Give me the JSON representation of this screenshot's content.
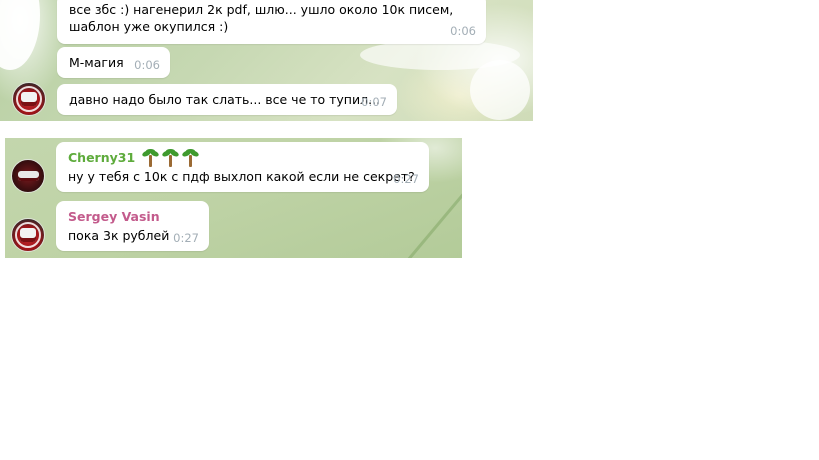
{
  "panel1": {
    "messages": [
      {
        "text": "все збс :) нагенерил 2к pdf, шлю... ушло около 10к писем,\nшаблон уже окупился :)",
        "time": "0:06"
      },
      {
        "text": "М-магия",
        "time": "0:06"
      },
      {
        "text": "давно надо было так слать... все че то тупил...",
        "time": "0:07"
      }
    ]
  },
  "panel2": {
    "messages": [
      {
        "sender": "Cherny31",
        "emoji": "🌴🌴🌴",
        "text": "ну у тебя с 10к с пдф выхлоп какой если не секрет?",
        "time": "0:27"
      },
      {
        "sender": "Sergey Vasin",
        "text": "пока 3к рублей",
        "time": "0:27"
      }
    ]
  },
  "colors": {
    "sender_cherny": "#5eab3c",
    "sender_sergey": "#c35b8c",
    "time": "#a3aeb6",
    "bubble": "#ffffff"
  },
  "icons": {
    "avatar_sergey": "avatar-red-logo",
    "avatar_cherny": "avatar-mouth-logo",
    "emoji": "palm-tree-icon"
  }
}
